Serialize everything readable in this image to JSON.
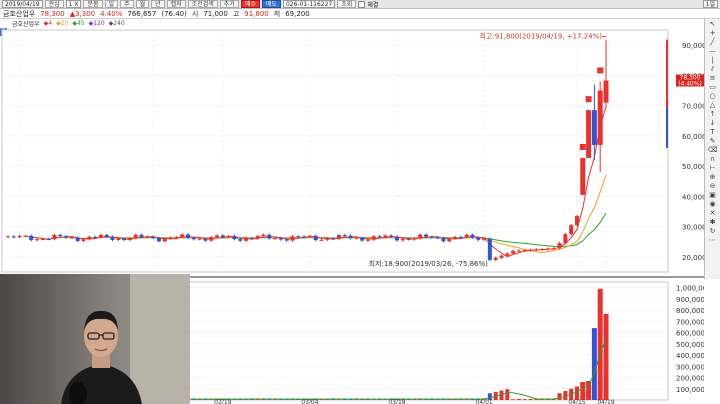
{
  "toolbar": {
    "date": "2019/04/19",
    "btn_left": "관심",
    "period": "1 X",
    "options": [
      "분봉",
      "일",
      "주",
      "월",
      "년"
    ],
    "btn_capture": "캡처",
    "btn_condition": "조건검색",
    "btn_add": "추가",
    "btn_buy": "매수",
    "btn_sell": "매도",
    "account": "026-01-116227",
    "btn_lookup": "조회",
    "check_label": "체결",
    "page_indicator": "1일"
  },
  "info": {
    "stock_name": "금호산업우",
    "price": "78,300",
    "change": "▲3,300",
    "change_pct": "4.40%",
    "volume": "766,657",
    "volume_pct": "(76.40)",
    "open_label": "시",
    "open": "71,000",
    "high_label": "고",
    "high": "91,800",
    "low_label": "저",
    "low": "69,200"
  },
  "legend": {
    "name": "금호산업우",
    "ma1": "4",
    "ma2": "20",
    "ma3": "45",
    "ma4": "120",
    "ma5": "240"
  },
  "left_strip": "또",
  "annotations": {
    "max": "최고:91,800(2019/04/19, +17.24%)",
    "min": "최저:18,900(2019/03/26, -75.86%)",
    "current_price": "78,300",
    "current_pct": "(4.40%)"
  },
  "chart_data": {
    "type": "candlestick",
    "price_axis": [
      "90,000",
      "80,000",
      "70,000",
      "60,000",
      "50,000",
      "40,000",
      "30,000",
      "20,000"
    ],
    "volume_axis": [
      "1,000,000",
      "900,000",
      "800,000",
      "700,000",
      "600,000",
      "500,000",
      "400,000",
      "300,000",
      "200,000",
      "100,000"
    ],
    "x_ticks": [
      "01/14",
      "02/07",
      "02/19",
      "03/04",
      "03/18",
      "04/01",
      "04/15",
      "04/19"
    ],
    "ylim": [
      15000,
      95000
    ],
    "volume_ylim": [
      0,
      1050000
    ],
    "last_candles": [
      {
        "date": "04/15",
        "open": 40500,
        "close": 52700,
        "high": 52700,
        "low": 40500
      },
      {
        "date": "04/16",
        "open": 52700,
        "close": 68500,
        "high": 68500,
        "low": 52700
      },
      {
        "date": "04/17",
        "open": 68500,
        "close": 57000,
        "high": 77000,
        "low": 52000
      },
      {
        "date": "04/18",
        "open": 57000,
        "close": 75000,
        "high": 78000,
        "low": 48000
      },
      {
        "date": "04/19",
        "open": 71000,
        "close": 78300,
        "high": 91800,
        "low": 69200
      }
    ],
    "last_volumes": [
      160000,
      170000,
      640000,
      990000,
      766657
    ],
    "colors": {
      "up": "#e8322e",
      "down": "#2f55d6",
      "ma_short": "#e8322e",
      "ma_mid": "#f0a020",
      "ma_long": "#2ca02c"
    }
  }
}
